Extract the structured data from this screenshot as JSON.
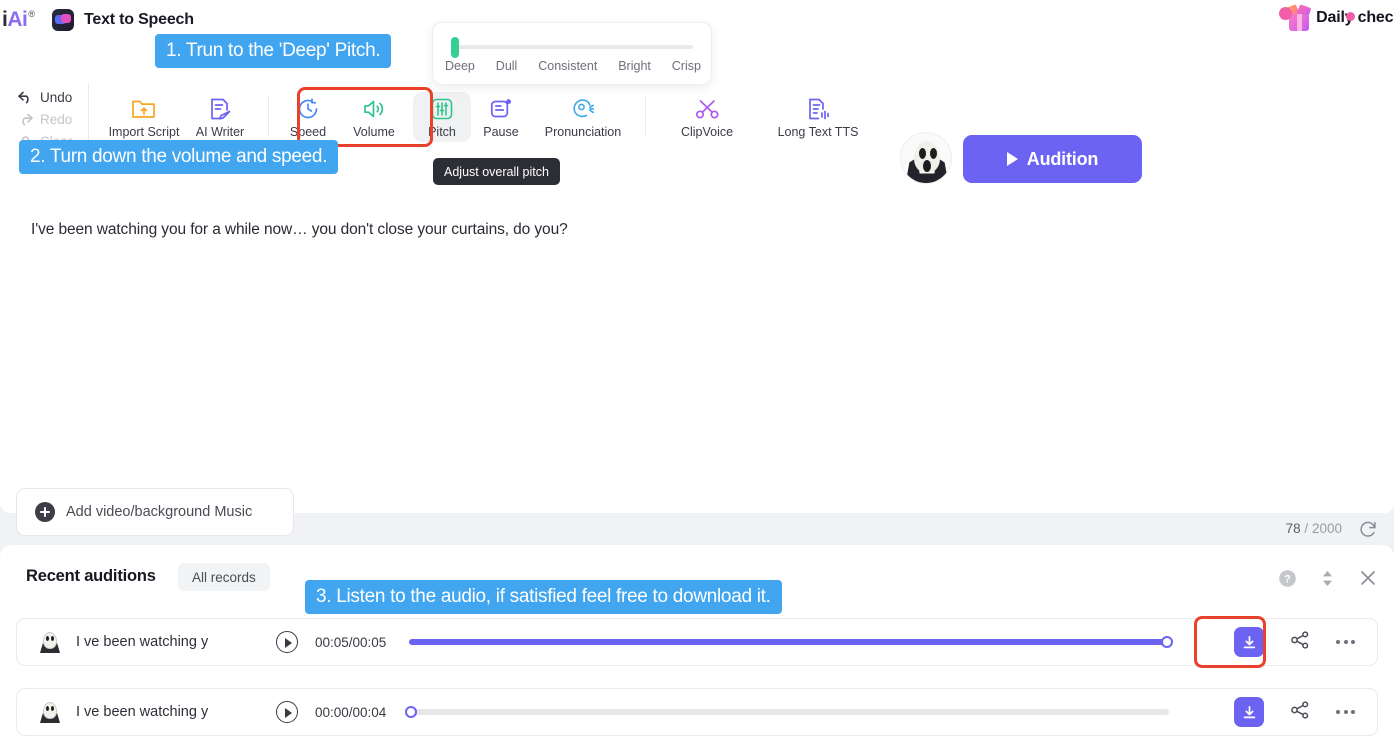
{
  "topbar": {
    "logo": {
      "i": "i",
      "a": "Ai",
      "reg": "®"
    },
    "app_title": "Text to Speech",
    "daily_check": "Daily check",
    "app_icon_name": "text-to-speech-app-icon"
  },
  "side_actions": [
    {
      "label": "Undo",
      "icon": "undo-icon",
      "disabled": false
    },
    {
      "label": "Redo",
      "icon": "redo-icon",
      "disabled": true
    },
    {
      "label": "Clear",
      "icon": "clear-icon",
      "disabled": true
    }
  ],
  "toolbar": {
    "tools": [
      {
        "label": "Import Script",
        "icon": "import-script-icon",
        "color": "#f5a623"
      },
      {
        "label": "AI Writer",
        "icon": "ai-writer-icon",
        "color": "#6c63f2"
      },
      {
        "label": "Speed",
        "icon": "speed-icon",
        "color": "#4a86f7"
      },
      {
        "label": "Volume",
        "icon": "volume-icon",
        "color": "#2fc48d"
      },
      {
        "label": "Pitch",
        "icon": "pitch-icon",
        "color": "#2fc48d",
        "active": true
      },
      {
        "label": "Pause",
        "icon": "pause-icon",
        "color": "#6c63f2"
      },
      {
        "label": "Pronunciation",
        "icon": "pronunciation-icon",
        "color": "#3fa9e8"
      },
      {
        "label": "ClipVoice",
        "icon": "clipvoice-icon",
        "color": "#b05bf0"
      },
      {
        "label": "Long Text TTS",
        "icon": "long-text-tts-icon",
        "color": "#6c63f2"
      }
    ],
    "audition_label": "Audition",
    "avatar_name": "scream-mask-avatar"
  },
  "pitch_popup": {
    "labels": [
      "Deep",
      "Dull",
      "Consistent",
      "Bright",
      "Crisp"
    ],
    "value_index": 0,
    "knob_color": "#35cf94"
  },
  "tooltip": {
    "text": "Adjust overall pitch"
  },
  "editor": {
    "script_text": "I've been watching you for a while now… you don't close your curtains, do you?",
    "add_media_label": "Add video/background Music",
    "char_count": "78",
    "char_limit": "2000",
    "char_separator": "/",
    "refresh_icon": "refresh-icon"
  },
  "auditions": {
    "title": "Recent auditions",
    "all_records_label": "All records",
    "header_icons": [
      "help-icon",
      "sort-updown-icon",
      "close-icon"
    ],
    "rows": [
      {
        "name": "I ve been watching y",
        "time": "00:05/00:05",
        "progress": 100,
        "download_icon": "download-icon",
        "share_icon": "share-icon",
        "more_icon": "more-options-icon"
      },
      {
        "name": "I ve been watching y",
        "time": "00:00/00:04",
        "progress": 0,
        "download_icon": "download-icon",
        "share_icon": "share-icon",
        "more_icon": "more-options-icon"
      }
    ]
  },
  "callouts": {
    "step1": "1. Trun to the 'Deep' Pitch.",
    "step2": "2. Turn down the volume and speed.",
    "step3": "3. Listen to the audio, if satisfied feel free to download it."
  },
  "colors": {
    "callout_blue": "#41a5f0",
    "highlight_red": "#e8422d",
    "accent_purple": "#6c63f2",
    "green": "#2fc48d"
  }
}
